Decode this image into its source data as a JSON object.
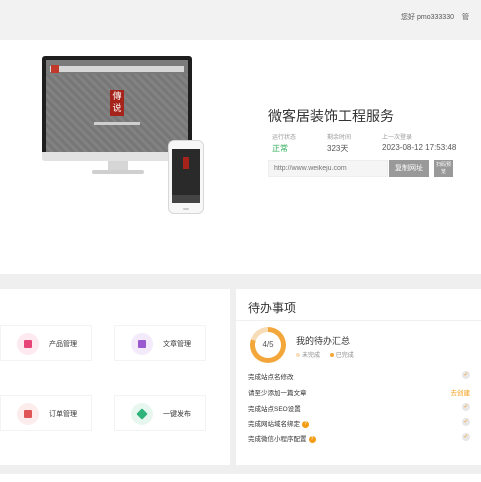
{
  "header": {
    "greeting": "您好",
    "username": "pmo333330",
    "more": "管"
  },
  "hero": {
    "monitor_seal_text": "傳说",
    "site_title": "微客居装饰工程服务",
    "stats": [
      {
        "label": "运行状态",
        "value": "正常"
      },
      {
        "label": "剩余时间",
        "value": "323天"
      },
      {
        "label": "上一次登录",
        "value": "2023-08-12 17:53:48"
      }
    ],
    "url_placeholder": "http://www.weikeju.com",
    "copy_button": "复制网址",
    "qr_button": "扫码预览"
  },
  "modules": [
    {
      "label": "产品管理",
      "icon": "product-icon",
      "color": "#e8447a",
      "bg": "#fdeaf1"
    },
    {
      "label": "文章管理",
      "icon": "article-icon",
      "color": "#9b59d0",
      "bg": "#f3eafb"
    },
    {
      "label": "订单管理",
      "icon": "order-icon",
      "color": "#e05656",
      "bg": "#fdecec"
    },
    {
      "label": "一键发布",
      "icon": "send-icon",
      "color": "#2fb37a",
      "bg": "#e7f7ef"
    }
  ],
  "todo": {
    "title": "待办事项",
    "progress": "4/5",
    "progress_fraction": 0.8,
    "summary_title": "我的待办汇总",
    "legend_pending": "未完成",
    "legend_done": "已完成",
    "tasks": [
      {
        "label": "完成站点名修改",
        "status": "done"
      },
      {
        "label": "请至少添加一篇文章",
        "status": "pending",
        "action": "去创建"
      },
      {
        "label": "完成站点SEO设置",
        "status": "done"
      },
      {
        "label": "完成网站域名绑定",
        "status": "done",
        "help": "?"
      },
      {
        "label": "完成微信小程序配置",
        "status": "done",
        "help": "?"
      }
    ]
  },
  "colors": {
    "accent": "#f39c12",
    "ok": "#2fae5a"
  }
}
